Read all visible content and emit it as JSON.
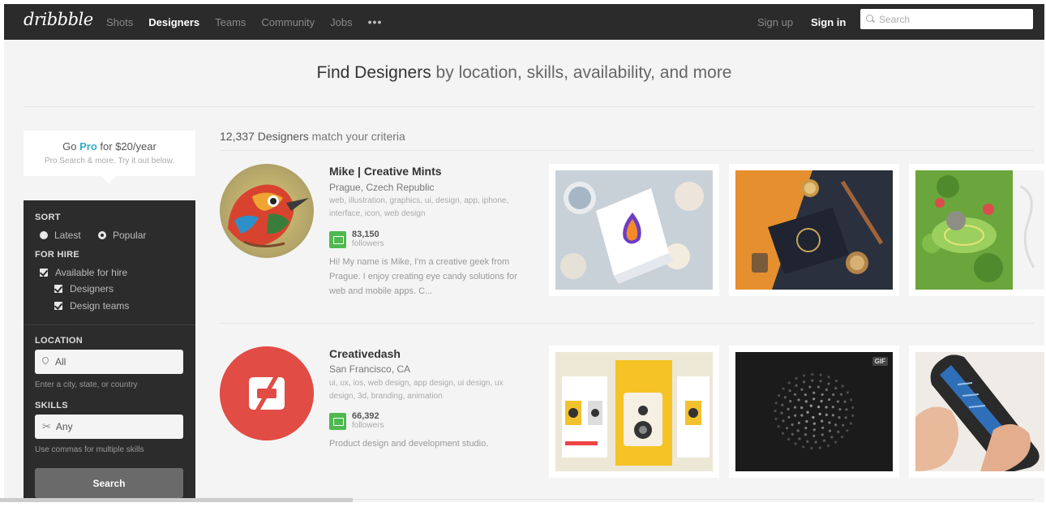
{
  "nav": {
    "logo": "dribbble",
    "items": [
      "Shots",
      "Designers",
      "Teams",
      "Community",
      "Jobs"
    ],
    "more": "•••",
    "sign_up": "Sign up",
    "sign_in": "Sign in",
    "search_placeholder": "Search"
  },
  "heading": {
    "bold": "Find Designers",
    "rest": " by location, skills, availability, and more"
  },
  "gopro": {
    "pre": "Go ",
    "pro": "Pro",
    "post": " for $20/year",
    "sub": "Pro Search & more. Try it out below."
  },
  "sidebar": {
    "sort_title": "SORT",
    "sort_latest": "Latest",
    "sort_popular": "Popular",
    "forhire_title": "FOR HIRE",
    "available": "Available for hire",
    "designers": "Designers",
    "design_teams": "Design teams",
    "location_title": "LOCATION",
    "location_value": "All",
    "location_hint": "Enter a city, state, or country",
    "skills_title": "SKILLS",
    "skills_value": "Any",
    "skills_hint": "Use commas for multiple skills",
    "search_button": "Search"
  },
  "results": {
    "count": "12,337 Designers",
    "suffix": " match your criteria"
  },
  "designers": [
    {
      "name": "Mike | Creative Mints",
      "location": "Prague, Czech Republic",
      "skills": "web, illustration, graphics, ui, design, app, iphone, interface, icon, web design",
      "followers": "83,150",
      "followers_label": "followers",
      "bio": "Hi! My name is Mike, I'm a creative geek from Prague. I enjoy creating eye candy solutions for web and mobile apps. C..."
    },
    {
      "name": "Creativedash",
      "location": "San Francisco, CA",
      "skills": "ui, ux, ios, web design, app design, ui design, ux design, 3d, branding, animation",
      "followers": "66,392",
      "followers_label": "followers",
      "bio": "Product design and development studio."
    }
  ],
  "shots": {
    "gif_badge": "GIF"
  },
  "colors": {
    "topbar": "#2b2b2b",
    "sidebar": "#2c2c2c",
    "accent": "#34aec9",
    "followers_icon": "#50b850",
    "creativedash": "#e14c45"
  }
}
